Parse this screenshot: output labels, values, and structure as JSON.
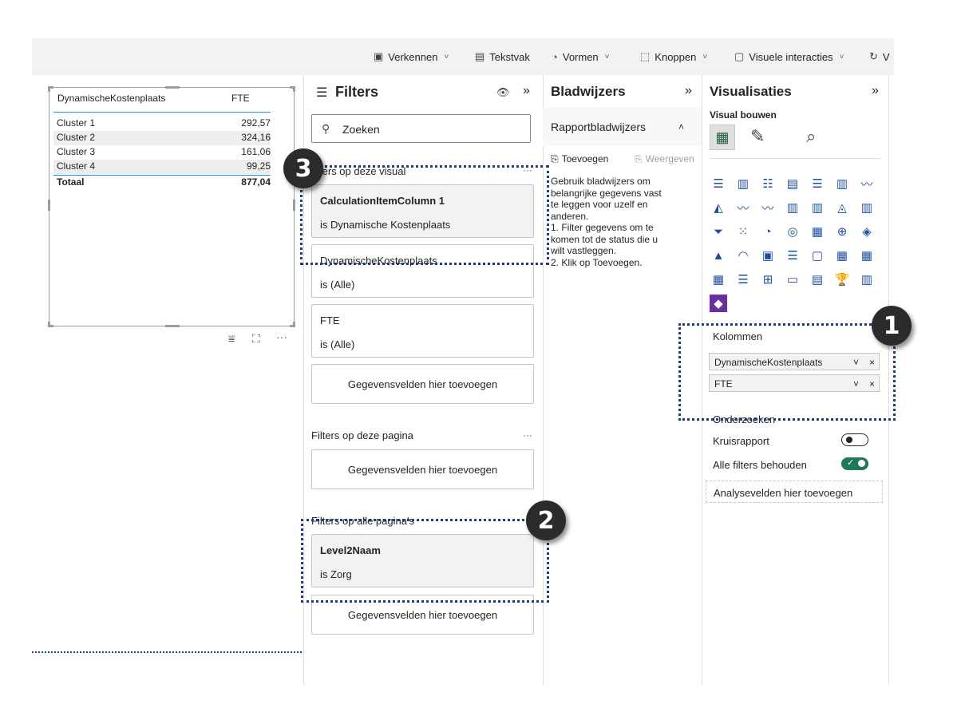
{
  "ribbon": {
    "items": [
      {
        "label": "Verkennen",
        "icon": "explore-icon",
        "chevron": "˅"
      },
      {
        "label": "Tekstvak",
        "icon": "textbox-icon",
        "chevron": ""
      },
      {
        "label": "Vormen",
        "icon": "shapes-icon",
        "chevron": "˅"
      },
      {
        "label": "Knoppen",
        "icon": "buttons-icon",
        "chevron": "˅"
      },
      {
        "label": "Visuele interacties",
        "icon": "visual-interactions-icon",
        "chevron": "˅"
      },
      {
        "label": "V",
        "icon": "refresh-icon",
        "chevron": ""
      }
    ]
  },
  "table_visual": {
    "columns": [
      "DynamischeKostenplaats",
      "FTE"
    ],
    "rows": [
      {
        "name": "Cluster 1",
        "value": "292,57"
      },
      {
        "name": "Cluster 2",
        "value": "324,16"
      },
      {
        "name": "Cluster 3",
        "value": "161,06"
      },
      {
        "name": "Cluster 4",
        "value": "99,25"
      }
    ],
    "total": {
      "name": "Totaal",
      "value": "877,04"
    },
    "footer_icons": [
      "filter-icon",
      "focus-mode-icon",
      "more-options-icon"
    ]
  },
  "filters": {
    "title": "Filters",
    "search_value": "Zoeken",
    "visual_section": "ters op deze visual",
    "visual_more": "···",
    "cards_visual": [
      {
        "field": "CalculationItemColumn 1",
        "state": "is Dynamische Kostenplaats"
      },
      {
        "field": "DynamischeKostenplaats",
        "state": "is (Alle)"
      },
      {
        "field": "FTE",
        "state": "is (Alle)"
      }
    ],
    "add_fields": "Gegevensvelden hier toevoegen",
    "page_section": "Filters op deze pagina",
    "page_more": "···",
    "all_pages_section": "Filters op alle pagina's",
    "card_all_pages": {
      "field": "Level2Naam",
      "state": "is Zorg"
    }
  },
  "bookmarks": {
    "title": "Bladwijzers",
    "expand": "»",
    "section": "Rapportbladwijzers",
    "section_chevron": "˄",
    "add_label": "Toevoegen",
    "view_label": "Weergeven",
    "help_lines": [
      "Gebruik bladwijzers om",
      "belangrijke gegevens vast",
      "te leggen voor uzelf en",
      "anderen.",
      "1. Filter gegevens om te",
      "komen tot de status die u",
      "wilt vastleggen.",
      "2. Klik op Toevoegen."
    ]
  },
  "visualisaties": {
    "title": "Visualisaties",
    "expand": "»",
    "subtitle": "Visual bouwen",
    "columns_label": "Kolommen",
    "fields": [
      {
        "name": "DynamischeKostenplaats",
        "chev": "˅",
        "x": "×"
      },
      {
        "name": "FTE",
        "chev": "˅",
        "x": "×"
      }
    ],
    "drill_label": "Onderzoeken",
    "cross_report": "Kruisrapport",
    "cross_report_on": false,
    "keep_filters": "Alle filters behouden",
    "keep_filters_on": true,
    "drill_fields": "Analysevelden hier toevoegen"
  },
  "badges": [
    "1",
    "2",
    "3"
  ],
  "colors": {
    "accent": "#118dff",
    "annotation": "#1f3f7a",
    "toggle_on": "#1e7a56"
  }
}
